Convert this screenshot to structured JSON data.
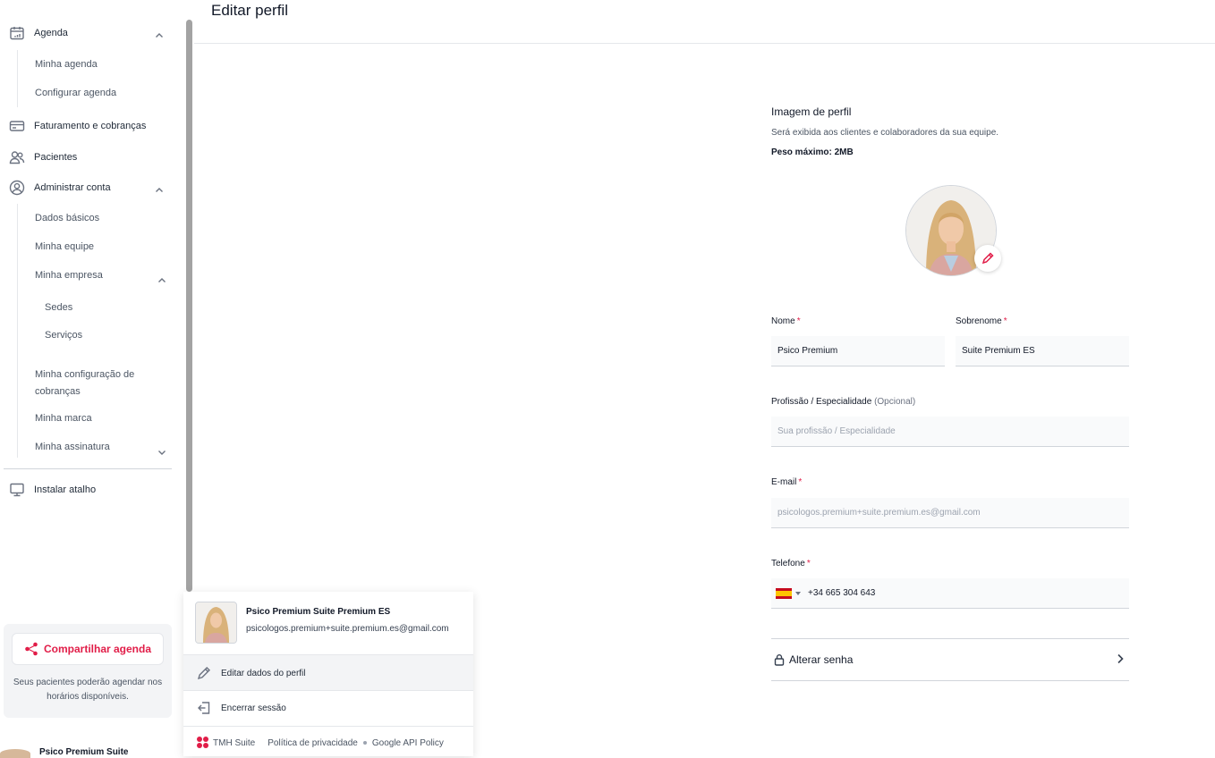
{
  "page": {
    "title": "Editar perfil"
  },
  "sidebar": {
    "agenda": {
      "label": "Agenda",
      "children": [
        "Minha agenda",
        "Configurar agenda"
      ]
    },
    "billing": {
      "label": "Faturamento e cobranças"
    },
    "patients": {
      "label": "Pacientes"
    },
    "account": {
      "label": "Administrar conta",
      "children": {
        "basic": "Dados básicos",
        "team": "Minha equipe",
        "company": "Minha empresa",
        "company_children": [
          "Sedes",
          "Serviços"
        ],
        "billing_config": "Minha configuração de cobranças",
        "brand": "Minha marca",
        "subscription": "Minha assinatura"
      }
    },
    "shortcut": {
      "label": "Instalar atalho"
    },
    "share": {
      "button": "Compartilhar agenda",
      "text": "Seus pacientes poderão agendar nos horários disponíveis."
    },
    "bottom_user": "Psico Premium Suite"
  },
  "profile_image": {
    "title": "Imagem de perfil",
    "description": "Será exibida aos clientes e colaboradores da sua equipe.",
    "max_size": "Peso máximo: 2MB"
  },
  "form": {
    "name": {
      "label": "Nome",
      "value": "Psico Premium"
    },
    "surname": {
      "label": "Sobrenome",
      "value": "Suite Premium ES"
    },
    "profession": {
      "label": "Profissão / Especialidade",
      "optional": "(Opcional)",
      "placeholder": "Sua profissão / Especialidade"
    },
    "email": {
      "label": "E-mail",
      "value": "psicologos.premium+suite.premium.es@gmail.com"
    },
    "phone": {
      "label": "Telefone",
      "value": "+34 665 304 643"
    },
    "required_mark": "*",
    "change_password": "Alterar senha"
  },
  "user_menu": {
    "name": "Psico Premium Suite Premium ES",
    "email": "psicologos.premium+suite.premium.es@gmail.com",
    "edit": "Editar dados do perfil",
    "logout": "Encerrar sessão",
    "footer": {
      "brand": "TMH Suite",
      "privacy": "Política de privacidade",
      "google": "Google API Policy"
    }
  },
  "colors": {
    "accent": "#e11d48",
    "scrollbar": "#a3a3a3"
  }
}
